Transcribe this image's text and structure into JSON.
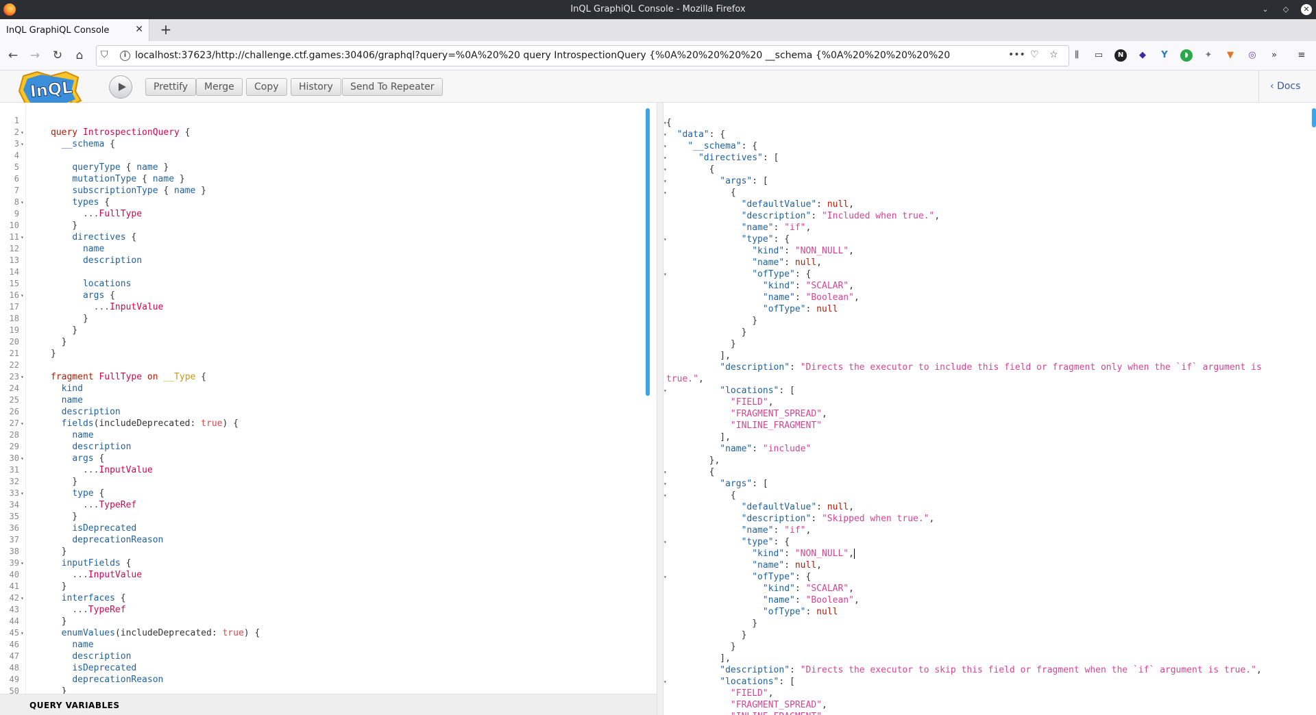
{
  "window": {
    "title": "InQL GraphiQL Console - Mozilla Firefox"
  },
  "tab": {
    "label": "InQL GraphiQL Console"
  },
  "address": {
    "url": "localhost:37623/http://challenge.ctf.games:30406/graphql?query=%0A%20%20 query IntrospectionQuery {%0A%20%20%20%20 __schema {%0A%20%20%20%20%20%20 %0A%20%"
  },
  "toolbar": {
    "prettify": "Prettify",
    "merge": "Merge",
    "copy": "Copy",
    "history": "History",
    "send": "Send To Repeater",
    "docs": "Docs"
  },
  "bottom": {
    "query_variables": "QUERY VARIABLES"
  },
  "editor": {
    "lines": [
      {
        "n": "1",
        "f": "",
        "t": ""
      },
      {
        "n": "2",
        "f": "▾",
        "t": "query IntrospectionQuery {"
      },
      {
        "n": "3",
        "f": "▾",
        "t": "  __schema {"
      },
      {
        "n": "4",
        "f": "",
        "t": ""
      },
      {
        "n": "5",
        "f": "",
        "t": "    queryType { name }"
      },
      {
        "n": "6",
        "f": "",
        "t": "    mutationType { name }"
      },
      {
        "n": "7",
        "f": "",
        "t": "    subscriptionType { name }"
      },
      {
        "n": "8",
        "f": "▾",
        "t": "    types {"
      },
      {
        "n": "9",
        "f": "",
        "t": "      ...FullType"
      },
      {
        "n": "10",
        "f": "",
        "t": "    }"
      },
      {
        "n": "11",
        "f": "▾",
        "t": "    directives {"
      },
      {
        "n": "12",
        "f": "",
        "t": "      name"
      },
      {
        "n": "13",
        "f": "",
        "t": "      description"
      },
      {
        "n": "14",
        "f": "",
        "t": ""
      },
      {
        "n": "15",
        "f": "",
        "t": "      locations"
      },
      {
        "n": "16",
        "f": "▾",
        "t": "      args {"
      },
      {
        "n": "17",
        "f": "",
        "t": "        ...InputValue"
      },
      {
        "n": "18",
        "f": "",
        "t": "      }"
      },
      {
        "n": "19",
        "f": "",
        "t": "    }"
      },
      {
        "n": "20",
        "f": "",
        "t": "  }"
      },
      {
        "n": "21",
        "f": "",
        "t": "}"
      },
      {
        "n": "22",
        "f": "",
        "t": ""
      },
      {
        "n": "23",
        "f": "▾",
        "t": "fragment FullType on __Type {"
      },
      {
        "n": "24",
        "f": "",
        "t": "  kind"
      },
      {
        "n": "25",
        "f": "",
        "t": "  name"
      },
      {
        "n": "26",
        "f": "",
        "t": "  description"
      },
      {
        "n": "27",
        "f": "▾",
        "t": "  fields(includeDeprecated: true) {"
      },
      {
        "n": "28",
        "f": "",
        "t": "    name"
      },
      {
        "n": "29",
        "f": "",
        "t": "    description"
      },
      {
        "n": "30",
        "f": "▾",
        "t": "    args {"
      },
      {
        "n": "31",
        "f": "",
        "t": "      ...InputValue"
      },
      {
        "n": "32",
        "f": "",
        "t": "    }"
      },
      {
        "n": "33",
        "f": "▾",
        "t": "    type {"
      },
      {
        "n": "34",
        "f": "",
        "t": "      ...TypeRef"
      },
      {
        "n": "35",
        "f": "",
        "t": "    }"
      },
      {
        "n": "36",
        "f": "",
        "t": "    isDeprecated"
      },
      {
        "n": "37",
        "f": "",
        "t": "    deprecationReason"
      },
      {
        "n": "38",
        "f": "",
        "t": "  }"
      },
      {
        "n": "39",
        "f": "▾",
        "t": "  inputFields {"
      },
      {
        "n": "40",
        "f": "",
        "t": "    ...InputValue"
      },
      {
        "n": "41",
        "f": "",
        "t": "  }"
      },
      {
        "n": "42",
        "f": "▾",
        "t": "  interfaces {"
      },
      {
        "n": "43",
        "f": "",
        "t": "    ...TypeRef"
      },
      {
        "n": "44",
        "f": "",
        "t": "  }"
      },
      {
        "n": "45",
        "f": "▾",
        "t": "  enumValues(includeDeprecated: true) {"
      },
      {
        "n": "46",
        "f": "",
        "t": "    name"
      },
      {
        "n": "47",
        "f": "",
        "t": "    description"
      },
      {
        "n": "48",
        "f": "",
        "t": "    isDeprecated"
      },
      {
        "n": "49",
        "f": "",
        "t": "    deprecationReason"
      },
      {
        "n": "50",
        "f": "",
        "t": "  }"
      }
    ]
  },
  "result": {
    "lines": [
      {
        "f": "▾",
        "t": "{"
      },
      {
        "f": "▾",
        "t": "  \"data\": {"
      },
      {
        "f": "▾",
        "t": "    \"__schema\": {"
      },
      {
        "f": "▾",
        "t": "      \"directives\": ["
      },
      {
        "f": "▾",
        "t": "        {"
      },
      {
        "f": "▾",
        "t": "          \"args\": ["
      },
      {
        "f": "▾",
        "t": "            {"
      },
      {
        "f": "",
        "t": "              \"defaultValue\": null,"
      },
      {
        "f": "",
        "t": "              \"description\": \"Included when true.\","
      },
      {
        "f": "",
        "t": "              \"name\": \"if\","
      },
      {
        "f": "▾",
        "t": "              \"type\": {"
      },
      {
        "f": "",
        "t": "                \"kind\": \"NON_NULL\","
      },
      {
        "f": "",
        "t": "                \"name\": null,"
      },
      {
        "f": "▾",
        "t": "                \"ofType\": {"
      },
      {
        "f": "",
        "t": "                  \"kind\": \"SCALAR\","
      },
      {
        "f": "",
        "t": "                  \"name\": \"Boolean\","
      },
      {
        "f": "",
        "t": "                  \"ofType\": null"
      },
      {
        "f": "",
        "t": "                }"
      },
      {
        "f": "",
        "t": "              }"
      },
      {
        "f": "",
        "t": "            }"
      },
      {
        "f": "",
        "t": "          ],"
      },
      {
        "f": "",
        "t": "          \"description\": \"Directs the executor to include this field or fragment only when the `if` argument is"
      },
      {
        "f": "",
        "t": "true.\","
      },
      {
        "f": "▾",
        "t": "          \"locations\": ["
      },
      {
        "f": "",
        "t": "            \"FIELD\","
      },
      {
        "f": "",
        "t": "            \"FRAGMENT_SPREAD\","
      },
      {
        "f": "",
        "t": "            \"INLINE_FRAGMENT\""
      },
      {
        "f": "",
        "t": "          ],"
      },
      {
        "f": "",
        "t": "          \"name\": \"include\""
      },
      {
        "f": "",
        "t": "        },"
      },
      {
        "f": "▾",
        "t": "        {"
      },
      {
        "f": "▾",
        "t": "          \"args\": ["
      },
      {
        "f": "▾",
        "t": "            {"
      },
      {
        "f": "",
        "t": "              \"defaultValue\": null,"
      },
      {
        "f": "",
        "t": "              \"description\": \"Skipped when true.\","
      },
      {
        "f": "",
        "t": "              \"name\": \"if\","
      },
      {
        "f": "▾",
        "t": "              \"type\": {"
      },
      {
        "f": "",
        "t": "                \"kind\": \"NON_NULL\",|"
      },
      {
        "f": "",
        "t": "                \"name\": null,"
      },
      {
        "f": "▾",
        "t": "                \"ofType\": {"
      },
      {
        "f": "",
        "t": "                  \"kind\": \"SCALAR\","
      },
      {
        "f": "",
        "t": "                  \"name\": \"Boolean\","
      },
      {
        "f": "",
        "t": "                  \"ofType\": null"
      },
      {
        "f": "",
        "t": "                }"
      },
      {
        "f": "",
        "t": "              }"
      },
      {
        "f": "",
        "t": "            }"
      },
      {
        "f": "",
        "t": "          ],"
      },
      {
        "f": "",
        "t": "          \"description\": \"Directs the executor to skip this field or fragment when the `if` argument is true.\","
      },
      {
        "f": "▾",
        "t": "          \"locations\": ["
      },
      {
        "f": "",
        "t": "            \"FIELD\","
      },
      {
        "f": "",
        "t": "            \"FRAGMENT_SPREAD\","
      },
      {
        "f": "",
        "t": "            \"INLINE_FRAGMENT\""
      }
    ]
  }
}
